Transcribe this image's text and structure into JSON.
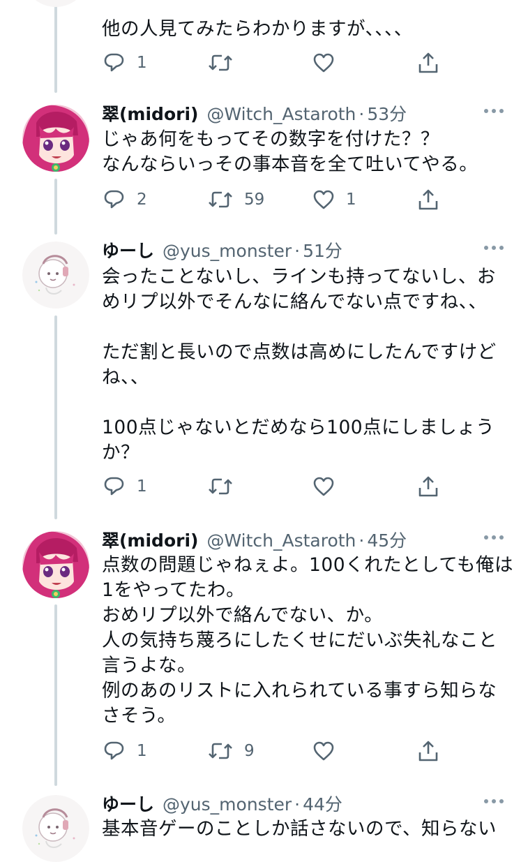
{
  "tweets": [
    {
      "text_lines": [
        "他の人見てみたらわかりますが、、、、"
      ],
      "reply_count": "1",
      "retweet_count": "",
      "like_count": ""
    },
    {
      "name": "翠(midori)",
      "handle": "@Witch_Astaroth",
      "time": "53分",
      "text_lines": [
        "じゃあ何をもってその数字を付けた？？",
        "なんならいっその事本音を全て吐いてやる。"
      ],
      "reply_count": "2",
      "retweet_count": "59",
      "like_count": "1"
    },
    {
      "name": "ゆーし",
      "handle": "@yus_monster",
      "time": "51分",
      "text_lines": [
        "会ったことないし、ラインも持ってないし、お",
        "めリプ以外でそんなに絡んでない点ですね、、",
        "",
        "ただ割と長いので点数は高めにしたんですけど",
        "ね、、",
        "",
        "100点じゃないとだめなら100点にしましょう",
        "か？"
      ],
      "reply_count": "1",
      "retweet_count": "",
      "like_count": ""
    },
    {
      "name": "翠(midori)",
      "handle": "@Witch_Astaroth",
      "time": "45分",
      "text_lines": [
        "点数の問題じゃねぇよ。100くれたとしても俺は",
        "1をやってたわ。",
        "おめリプ以外で絡んでない、か。",
        "人の気持ち蔑ろにしたくせにだいぶ失礼なこと",
        "言うよな。",
        "例のあのリストに入れられている事すら知らな",
        "さそう。"
      ],
      "reply_count": "1",
      "retweet_count": "9",
      "like_count": ""
    },
    {
      "name": "ゆーし",
      "handle": "@yus_monster",
      "time": "44分",
      "text_lines": [
        "基本音ゲーのことしか話さないので、知らない"
      ]
    }
  ],
  "colors": {
    "text": "#0f1419",
    "secondary": "#536471",
    "thread_line": "#cfd9de"
  },
  "icons": {
    "reply": "speech-bubble",
    "retweet": "retweet-arrows",
    "like": "heart-outline",
    "share": "share-upload",
    "more": "three-dots"
  }
}
